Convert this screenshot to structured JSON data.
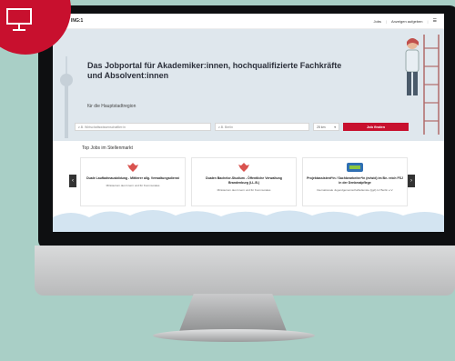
{
  "badge": {
    "icon": "monitor-icon",
    "color": "#c8102e"
  },
  "navbar": {
    "logo": "ING:1",
    "links": [
      "Jobs",
      "Anzeigen aufgeben"
    ],
    "menu_icon": "hamburger-icon"
  },
  "hero": {
    "title": "Das Jobportal für Akademiker:innen, hochqualifizierte Fachkräfte und Absolvent:innen",
    "subtitle": "für die Hauptstadtregion",
    "search": {
      "job_placeholder": "z.B. Wirtschaftswissenschaftler:in",
      "location_placeholder": "z.B. Berlin",
      "radius": "25 km",
      "button": "Job finden"
    }
  },
  "top_jobs": {
    "title": "Top Jobs im Stellenmarkt",
    "cards": [
      {
        "title": "Duale Laufbahnausbildung - Mittlerer allg. Verwaltungsdienst",
        "org": "Ministerium des Innern und für Kommunales"
      },
      {
        "title": "Dualen Bachelor-Studium - Öffentliche Verwaltung Brandenburg (LL.B.)",
        "org": "Ministerium des Innern und für Kommunales"
      },
      {
        "title": "Projektassistent*in / Sachbearbeiter*in (m/w/d) im Be- reich FSJ in der Denkmalpflege",
        "org": "Internationale Jugendgemeinschaftsdienste (ijgd) LV Berlin e.V."
      }
    ]
  },
  "colors": {
    "accent": "#c8102e",
    "background": "#a9cfc6"
  }
}
